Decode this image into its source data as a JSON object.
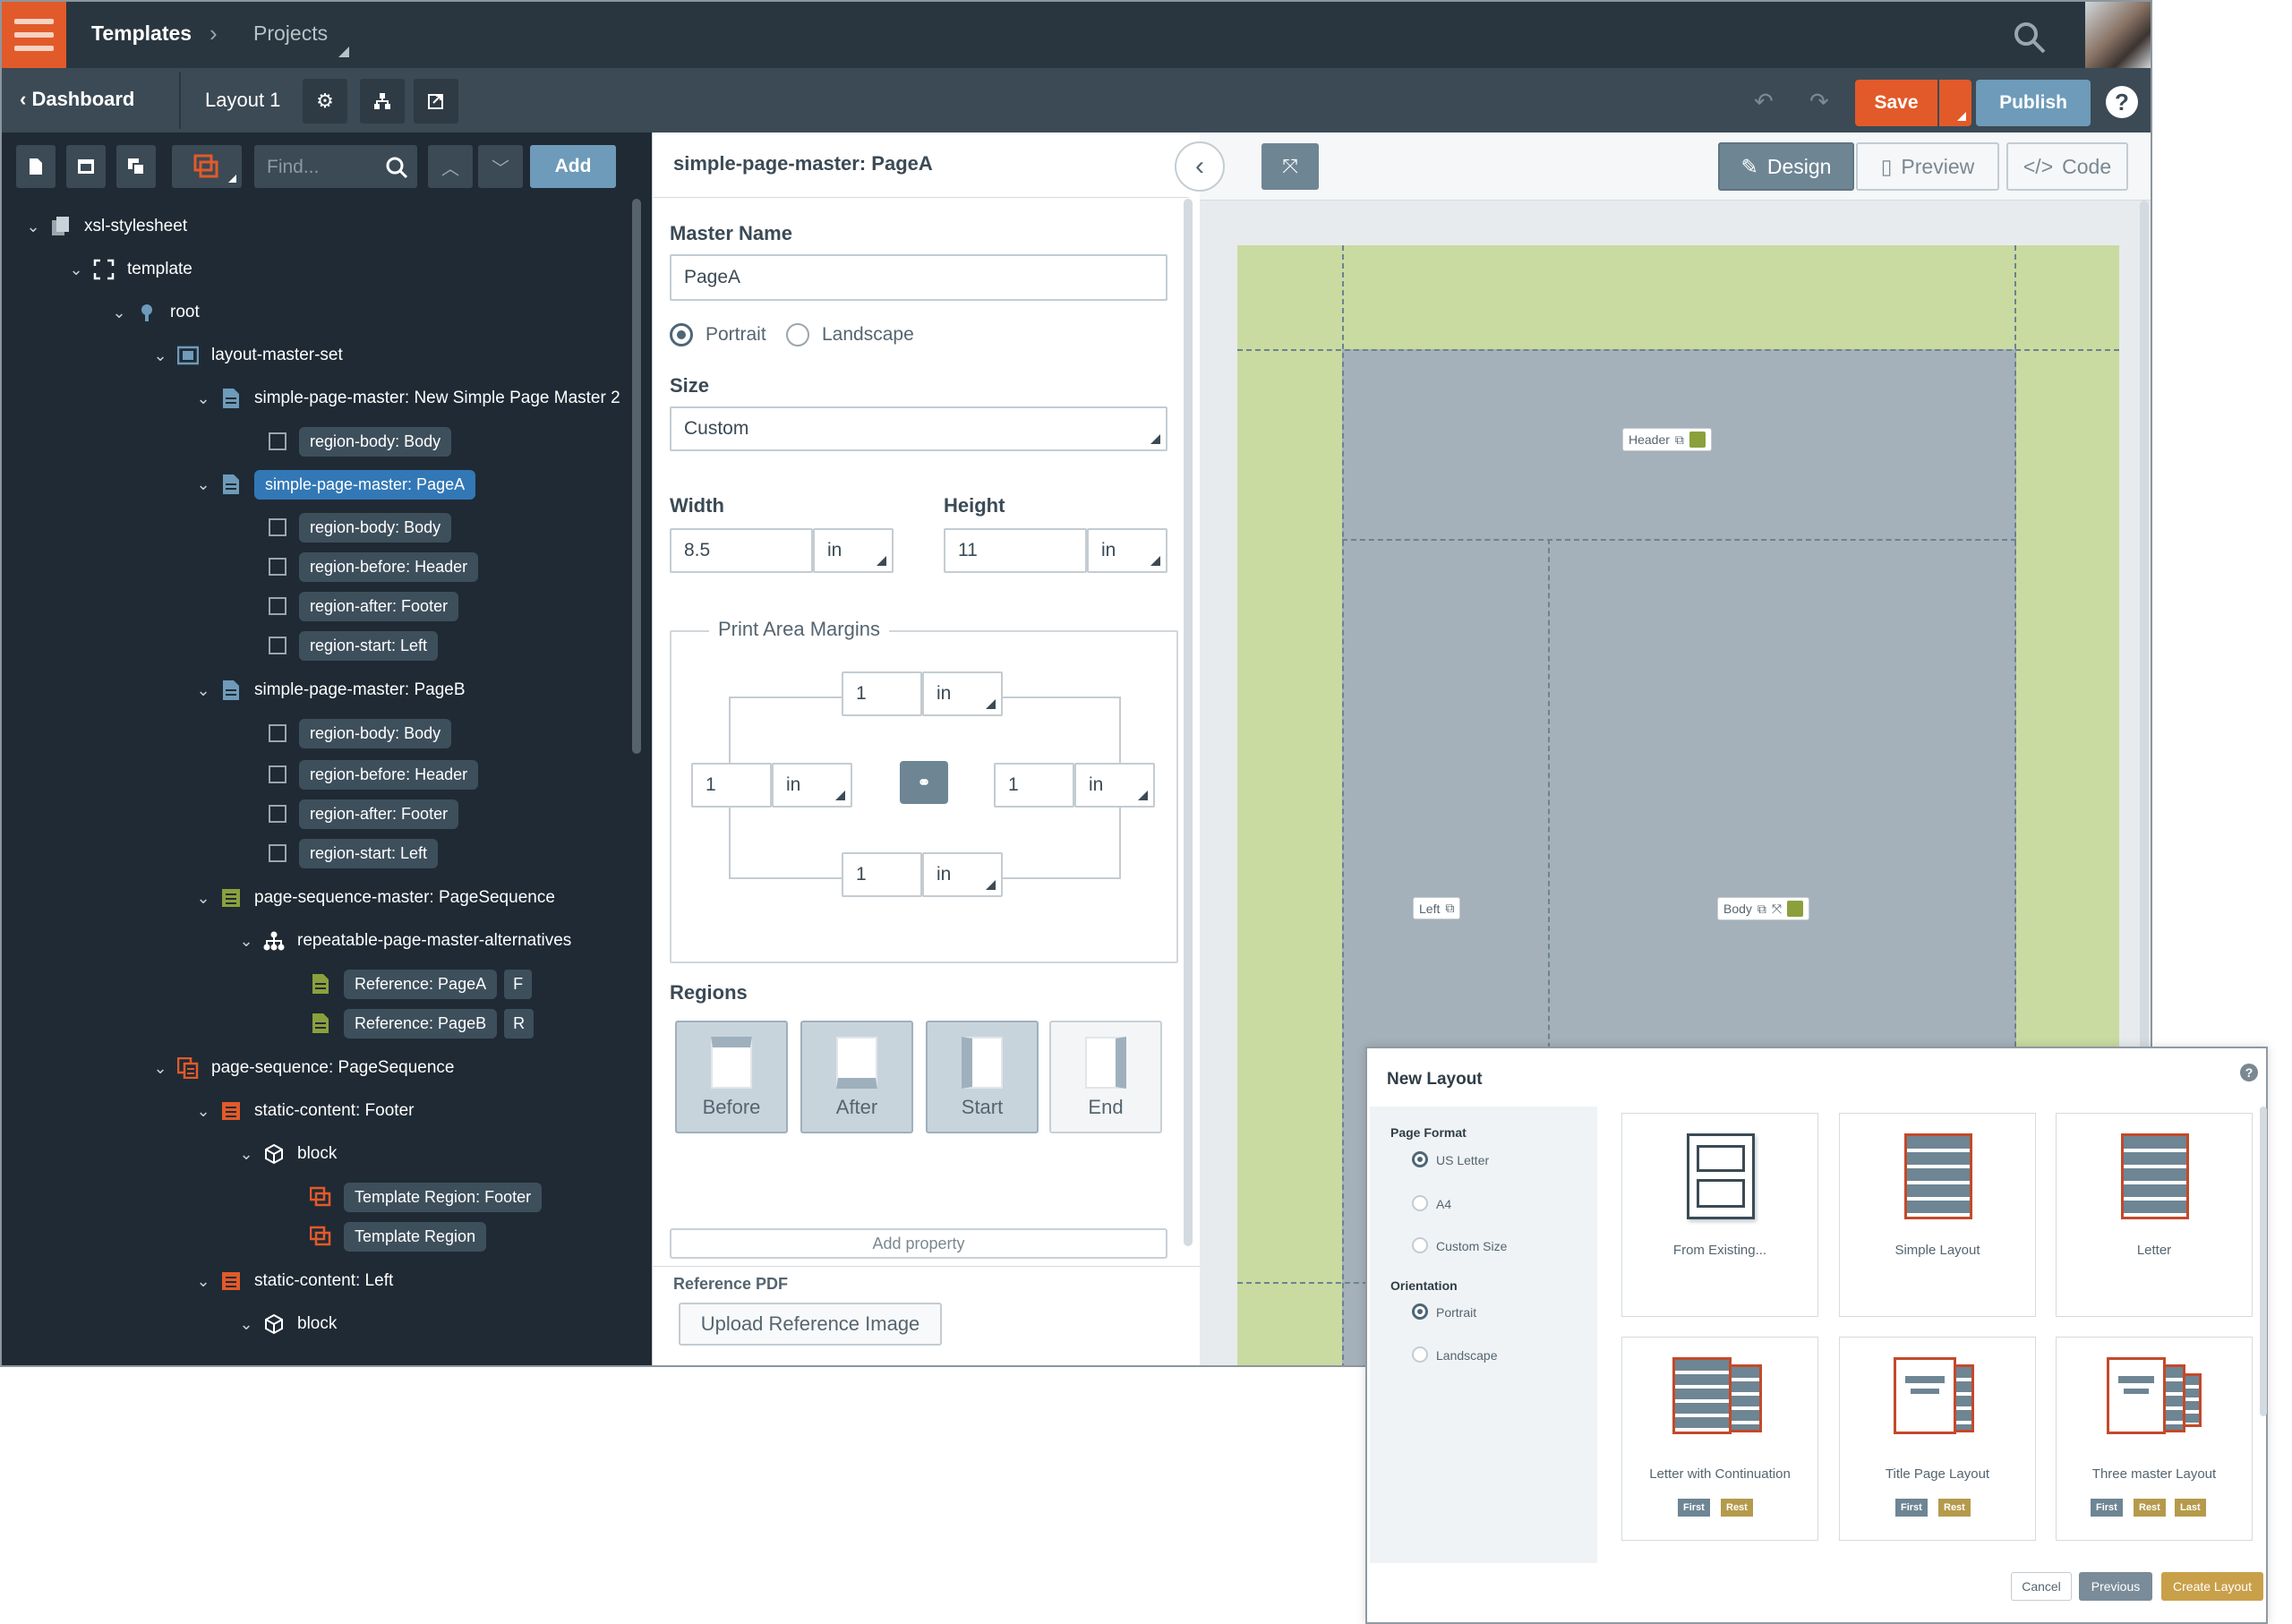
{
  "topbar": {
    "breadcrumb_root": "Templates",
    "breadcrumb_child": "Projects"
  },
  "toolbar": {
    "back_label": "Dashboard",
    "layout_name": "Layout 1",
    "save_label": "Save",
    "publish_label": "Publish",
    "help": "?"
  },
  "left": {
    "find_placeholder": "Find...",
    "add_label": "Add"
  },
  "tree": [
    {
      "label": "xsl-stylesheet"
    },
    {
      "label": "template"
    },
    {
      "label": "root"
    },
    {
      "label": "layout-master-set"
    },
    {
      "label": "simple-page-master: New Simple Page Master 2"
    },
    {
      "label": "region-body: Body"
    },
    {
      "label": "simple-page-master: PageA"
    },
    {
      "label": "region-body: Body"
    },
    {
      "label": "region-before: Header"
    },
    {
      "label": "region-after: Footer"
    },
    {
      "label": "region-start: Left"
    },
    {
      "label": "simple-page-master: PageB"
    },
    {
      "label": "region-body: Body"
    },
    {
      "label": "region-before: Header"
    },
    {
      "label": "region-after: Footer"
    },
    {
      "label": "region-start: Left"
    },
    {
      "label": "page-sequence-master: PageSequence"
    },
    {
      "label": "repeatable-page-master-alternatives"
    },
    {
      "label": "Reference: PageA",
      "tag": "F"
    },
    {
      "label": "Reference: PageB",
      "tag": "R"
    },
    {
      "label": "page-sequence: PageSequence"
    },
    {
      "label": "static-content: Footer"
    },
    {
      "label": "block"
    },
    {
      "label": "Template Region: Footer"
    },
    {
      "label": "Template Region"
    },
    {
      "label": "static-content: Left"
    },
    {
      "label": "block"
    }
  ],
  "props": {
    "title": "simple-page-master: PageA",
    "master_name_label": "Master Name",
    "master_name_value": "PageA",
    "portrait": "Portrait",
    "landscape": "Landscape",
    "size_label": "Size",
    "size_value": "Custom",
    "width_label": "Width",
    "width_value": "8.5",
    "height_label": "Height",
    "height_value": "11",
    "unit": "in",
    "margins_label": "Print Area Margins",
    "margin_top": "1",
    "margin_left": "1",
    "margin_right": "1",
    "margin_bottom": "1",
    "regions_label": "Regions",
    "regions": [
      "Before",
      "After",
      "Start",
      "End"
    ],
    "add_property": "Add property",
    "reference_pdf": "Reference PDF",
    "upload": "Upload Reference Image"
  },
  "canvas": {
    "tabs": [
      "Design",
      "Preview",
      "Code"
    ],
    "region_tags": {
      "header": "Header",
      "left": "Left",
      "body": "Body"
    }
  },
  "modal": {
    "title": "New Layout",
    "page_format_label": "Page Format",
    "formats": [
      "US Letter",
      "A4",
      "Custom Size"
    ],
    "orientation_label": "Orientation",
    "orientations": [
      "Portrait",
      "Landscape"
    ],
    "cards": [
      "From Existing...",
      "Simple Layout",
      "Letter",
      "Letter with Continuation",
      "Title Page Layout",
      "Three master Layout"
    ],
    "badges": {
      "first": "First",
      "rest": "Rest",
      "last": "Last"
    },
    "cancel": "Cancel",
    "previous": "Previous",
    "create": "Create Layout"
  },
  "colors": {
    "accent": "#e25a2a",
    "publish": "#6e9bb9",
    "selected": "#3378b6",
    "page_margin": "#c9dba0",
    "page_region": "#a5b1ba",
    "create_btn": "#c9a04a"
  }
}
